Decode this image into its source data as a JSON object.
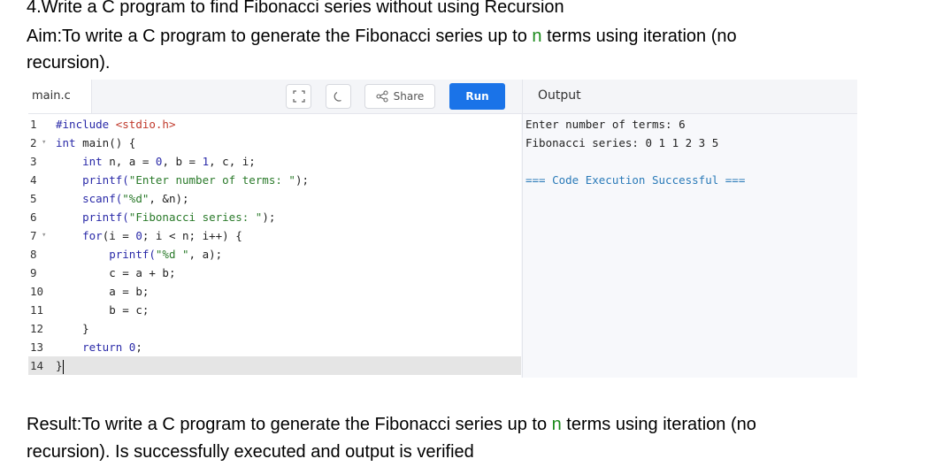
{
  "doc": {
    "heading": "4.Write a C program to find Fibonacci series without using Recursion",
    "aim_prefix": " Aim:To write a C program to generate the Fibonacci series up to ",
    "aim_highlight": "n",
    "aim_suffix": " terms using iteration (no",
    "aim_cont": "recursion).",
    "result_prefix": "Result:To write a C program to generate the Fibonacci series up to ",
    "result_highlight": "n",
    "result_suffix": " terms using iteration (no",
    "result_cont": "recursion). Is successfully executed and output is verified"
  },
  "editor": {
    "tab": "main.c",
    "share_label": "Share",
    "run_label": "Run",
    "output_label": "Output",
    "line_numbers": [
      "1",
      "2",
      "3",
      "4",
      "5",
      "6",
      "7",
      "8",
      "9",
      "10",
      "11",
      "12",
      "13",
      "14"
    ],
    "code": {
      "l1_inc": "#include",
      "l1_hdr": " <stdio.h>",
      "l2_kw": "int",
      "l2_rest": " main() {",
      "l3_kw": "int",
      "l3_a": " n, a = ",
      "l3_n0": "0",
      "l3_b": ", b = ",
      "l3_n1": "1",
      "l3_c": ", c, i;",
      "l4_fn": "printf(",
      "l4_str": "\"Enter number of terms: \"",
      "l4_end": ");",
      "l5_fn": "scanf(",
      "l5_str": "\"%d\"",
      "l5_end": ", &n);",
      "l6_fn": "printf(",
      "l6_str": "\"Fibonacci series: \"",
      "l6_end": ");",
      "l7_kw": "for",
      "l7_a": "(i = ",
      "l7_n0": "0",
      "l7_b": "; i < n; i++) {",
      "l8_fn": "printf(",
      "l8_str": "\"%d \"",
      "l8_end": ", a);",
      "l9": "c = a + b;",
      "l10": "a = b;",
      "l11": "b = c;",
      "l12": "}",
      "l13_kw": "return",
      "l13_sp": " ",
      "l13_n0": "0",
      "l13_end": ";",
      "l14": "}"
    },
    "output_lines": [
      "Enter number of terms: 6",
      "Fibonacci series: 0 1 1 2 3 5",
      "",
      "=== Code Execution Successful ==="
    ]
  },
  "colors": {
    "accent": "#1a8a1a",
    "run_button": "#1a73e8",
    "keyword": "#2a2aa8",
    "string": "#2a7a2a",
    "success": "#2a7ab8"
  }
}
